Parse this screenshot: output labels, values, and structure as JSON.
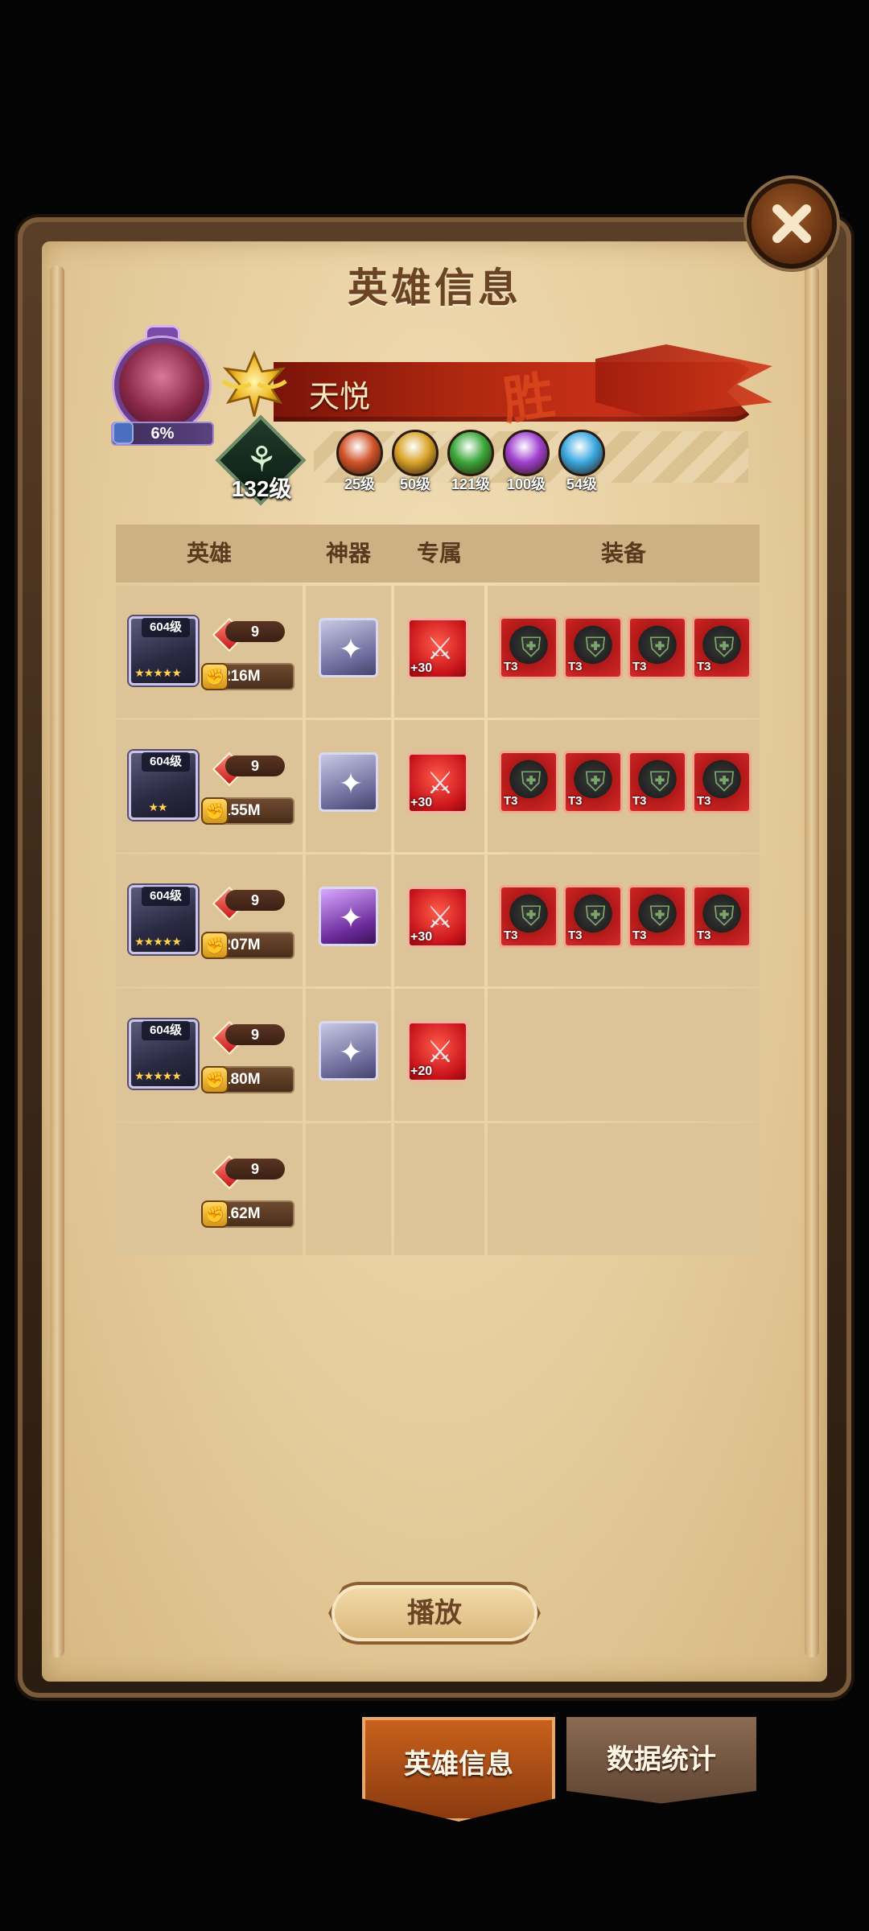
{
  "title": "英雄信息",
  "player": {
    "name": "天悦",
    "result": "胜",
    "progress_percent": "6%",
    "level": "132级"
  },
  "factions": [
    {
      "level": "25级",
      "color": "#d2542a",
      "icon": "fire-faction-icon"
    },
    {
      "level": "50级",
      "color": "#d9a42a",
      "icon": "shield-faction-icon"
    },
    {
      "level": "121级",
      "color": "#3aa83a",
      "icon": "leaf-faction-icon"
    },
    {
      "level": "100级",
      "color": "#a040d0",
      "icon": "void-faction-icon"
    },
    {
      "level": "54级",
      "color": "#3aa8e0",
      "icon": "ice-faction-icon"
    }
  ],
  "table": {
    "headers": {
      "hero": "英雄",
      "artifact": "神器",
      "exclusive": "专属",
      "equipment": "装备"
    },
    "rows": [
      {
        "hero_level": "604级",
        "stars": "★★★★★",
        "gem": "9",
        "power": "216M",
        "artifact": true,
        "artifact_style": "silver",
        "exclusive_plus": "+30",
        "equipment": [
          "T3",
          "T3",
          "T3",
          "T3"
        ]
      },
      {
        "hero_level": "604级",
        "stars": "★★",
        "gem": "9",
        "power": "155M",
        "artifact": true,
        "artifact_style": "silver",
        "exclusive_plus": "+30",
        "equipment": [
          "T3",
          "T3",
          "T3",
          "T3"
        ]
      },
      {
        "hero_level": "604级",
        "stars": "★★★★★",
        "gem": "9",
        "power": "207M",
        "artifact": true,
        "artifact_style": "purple",
        "exclusive_plus": "+30",
        "equipment": [
          "T3",
          "T3",
          "T3",
          "T3"
        ]
      },
      {
        "hero_level": "604级",
        "stars": "★★★★★",
        "gem": "9",
        "power": "180M",
        "artifact": true,
        "artifact_style": "silver",
        "exclusive_plus": "+20",
        "equipment": []
      },
      {
        "hero_level": "",
        "stars": "",
        "gem": "9",
        "power": "162M",
        "artifact": false,
        "exclusive_plus": "",
        "equipment": []
      }
    ]
  },
  "play_button": "播放",
  "tabs": {
    "hero_info": "英雄信息",
    "data_stats": "数据统计"
  },
  "colors": {
    "banner_red": "#b02810",
    "parchment": "#e6cc9c",
    "accent_orange": "#c8601c"
  }
}
